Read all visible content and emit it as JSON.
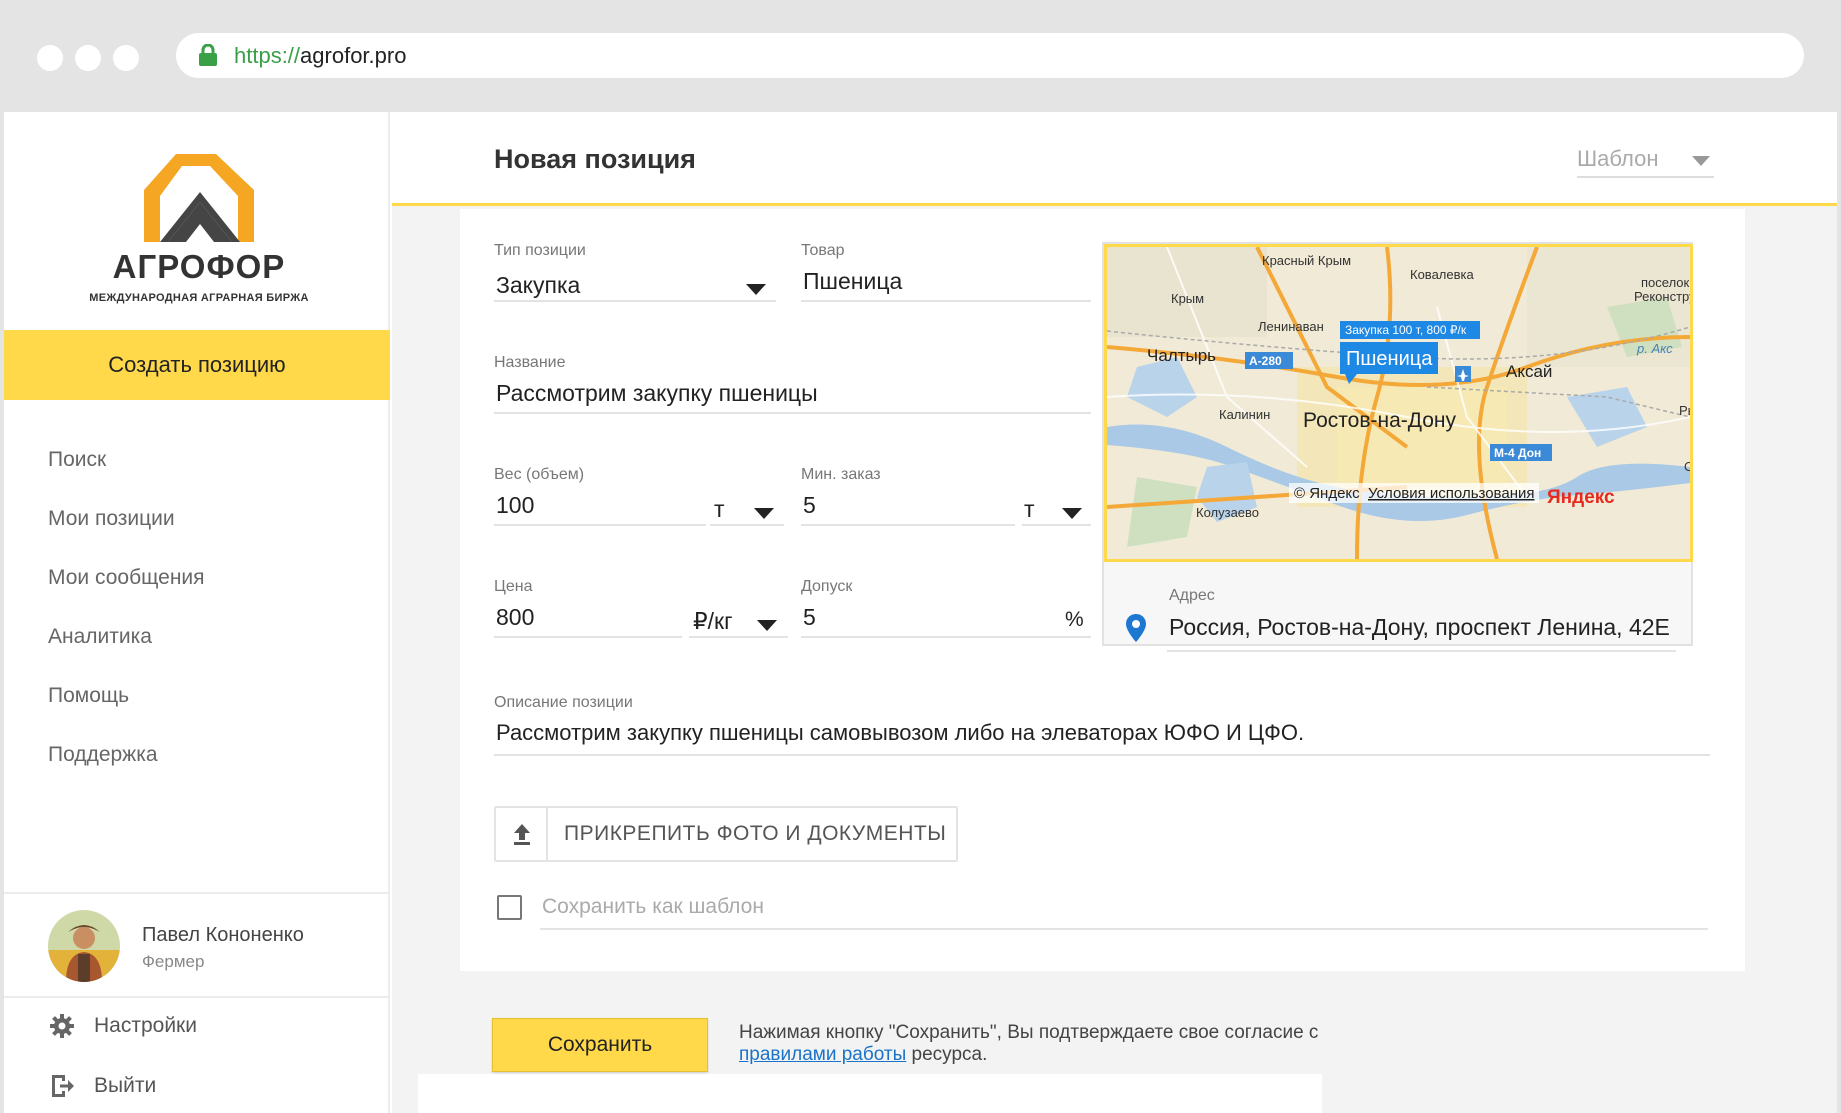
{
  "browser": {
    "url_protocol": "https://",
    "url_host": "agrofor.pro"
  },
  "sidebar": {
    "logo_title": "АГРОФОР",
    "logo_subtitle": "МЕЖДУНАРОДНАЯ АГРАРНАЯ БИРЖА",
    "create_button": "Создать позицию",
    "nav": [
      "Поиск",
      "Мои позиции",
      "Мои сообщения",
      "Аналитика",
      "Помощь",
      "Поддержка"
    ],
    "user": {
      "name": "Павел Кононенко",
      "role": "Фермер"
    },
    "settings": "Настройки",
    "logout": "Выйти"
  },
  "header": {
    "title": "Новая позиция",
    "template_select": "Шаблон"
  },
  "form": {
    "type": {
      "label": "Тип позиции",
      "value": "Закупка"
    },
    "product": {
      "label": "Товар",
      "value": "Пшеница"
    },
    "name": {
      "label": "Название",
      "value": "Рассмотрим закупку пшеницы"
    },
    "weight": {
      "label": "Вес (объем)",
      "value": "100",
      "unit": "т"
    },
    "min_order": {
      "label": "Мин. заказ",
      "value": "5",
      "unit": "т"
    },
    "price": {
      "label": "Цена",
      "value": "800",
      "unit": "₽/кг"
    },
    "tolerance": {
      "label": "Допуск",
      "value": "5",
      "unit": "%"
    },
    "description": {
      "label": "Описание позиции",
      "value": "Рассмотрим закупку пшеницы самовывозом либо на элеваторах ЮФО И ЦФО."
    },
    "attach_button": "ПРИКРЕПИТЬ ФОТО И ДОКУМЕНТЫ",
    "save_template": "Сохранить как шаблон",
    "save_button": "Сохранить",
    "agreement_prefix": "Нажимая кнопку \"Сохранить\", Вы подтверждаете свое согласие с",
    "agreement_link": "правилами работы",
    "agreement_suffix": "ресурса."
  },
  "map": {
    "address_label": "Адрес",
    "address_value": "Россия, Ростов-на-Дону, проспект Ленина, 42Е",
    "balloon_small": "Закупка 100 т, 800 ₽/к",
    "balloon_big": "Пшеница",
    "labels": {
      "krasny_krym": "Красный Крым",
      "kovalevka": "Ковалевка",
      "poselok": "поселок",
      "rekonstr": "Реконструк",
      "krym": "Крым",
      "leninavan": "Ленинаван",
      "chaltyr": "Чалтырь",
      "a280": "А-280",
      "aksay": "Аксай",
      "r_aks": "р. Акс",
      "kalinin": "Калинин",
      "rostov": "Ростов-на-Дону",
      "ryb": "Рыб",
      "m4": "М-4 Дон",
      "o": "О",
      "koluzaevo": "Колузаево",
      "copyright": "© Яндекс",
      "terms": "Условия использования",
      "yandex": "Яндекс"
    }
  },
  "colors": {
    "accent": "#ffd94a",
    "link": "#1a73c8",
    "pin": "#1e78d2",
    "balloon": "#1e88e5"
  }
}
